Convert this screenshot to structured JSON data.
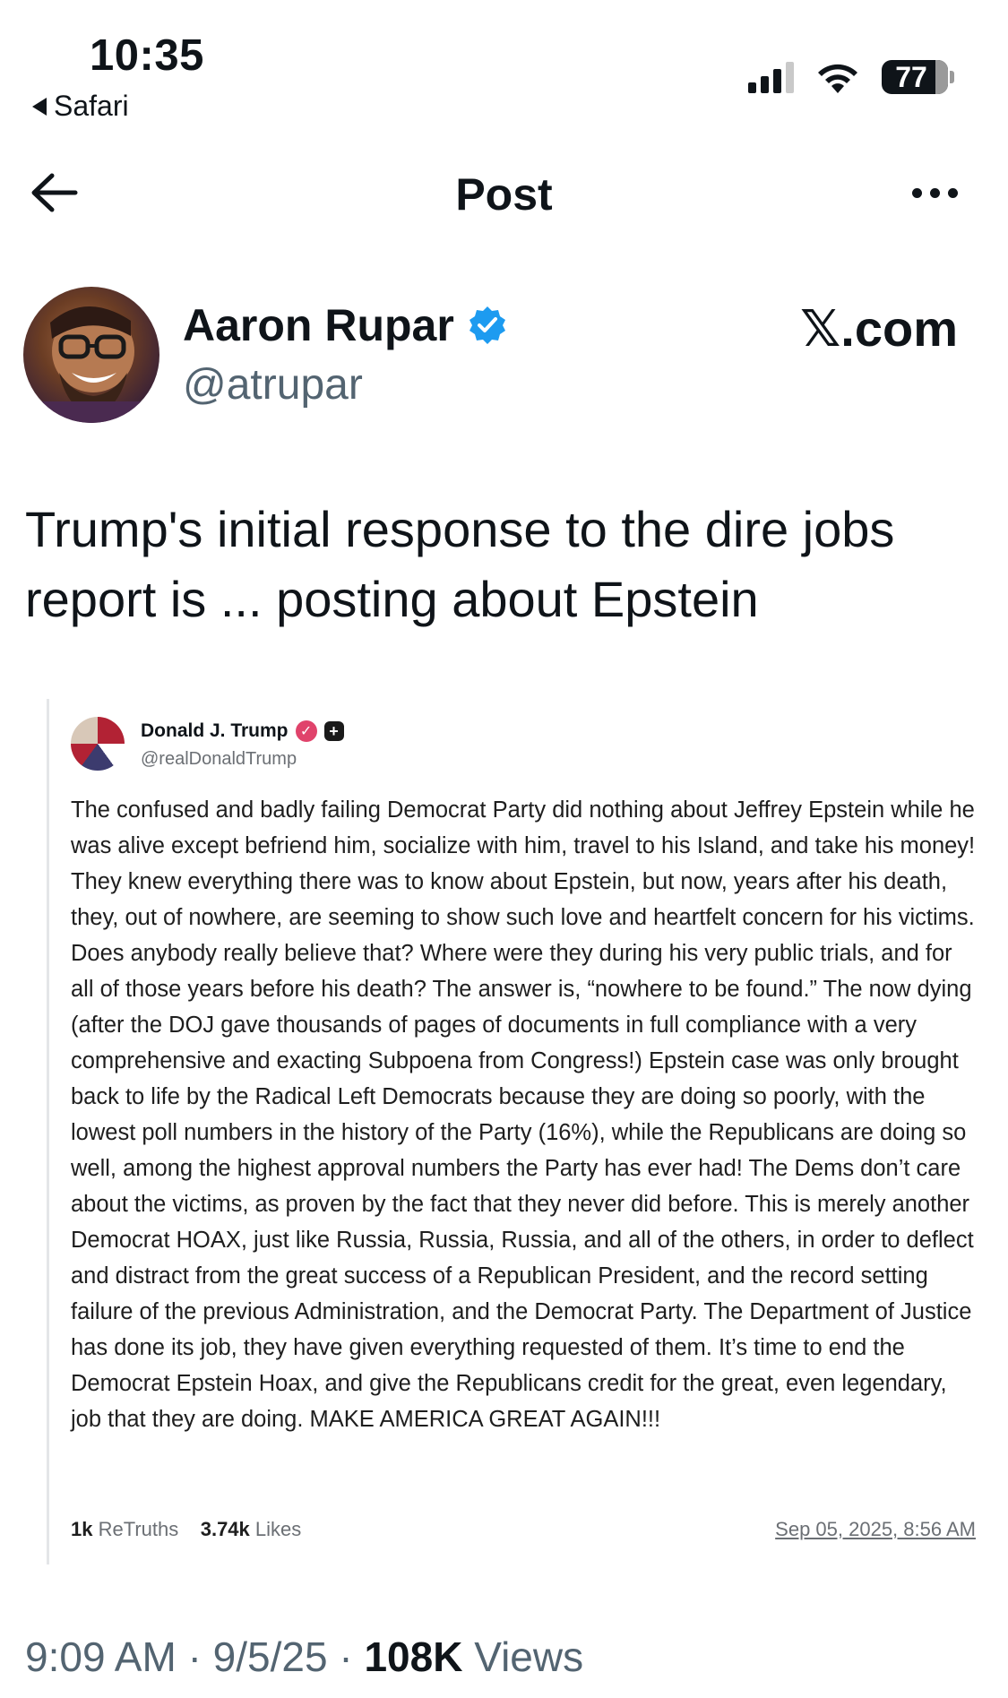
{
  "status_bar": {
    "time": "10:35",
    "back_app": "Safari",
    "battery": "77"
  },
  "header": {
    "title": "Post"
  },
  "author": {
    "name": "Aaron Rupar",
    "handle": "@atrupar",
    "site": "𝕏.com",
    "verified_color": "#1d9bf0"
  },
  "tweet": {
    "text": "Trump's initial response to the dire jobs report is ... posting about Epstein"
  },
  "embedded_post": {
    "name": "Donald J. Trump",
    "handle": "@realDonaldTrump",
    "body": "The confused and badly failing Democrat Party did nothing about Jeffrey Epstein while he was alive except befriend him, socialize with him, travel to his Island, and take his money! They knew everything there was to know about Epstein, but now, years after his death, they, out of nowhere, are seeming to show such love and heartfelt concern for his victims. Does anybody really believe that? Where were they during his very public trials, and for all of those years before his death? The answer is, “nowhere to be found.” The now dying (after the DOJ gave thousands of pages of documents in full compliance with a very comprehensive and exacting Subpoena from Congress!) Epstein case was only brought back to life by the Radical Left Democrats because they are doing so poorly, with the lowest poll numbers in the history of the Party (16%), while the Republicans are doing so well, among the highest approval numbers the Party has ever had! The Dems don’t care about the victims, as proven by the fact that they never did before. This is merely another Democrat HOAX, just like Russia, Russia, Russia, and all of the others, in order to deflect and distract from the great success of a Republican President, and the record setting failure of the previous Administration, and the Democrat Party. The Department of Justice has done its job, they have given everything requested of them. It’s time to end the Democrat Epstein Hoax, and give the Republicans credit for the great, even legendary, job that they are doing. MAKE AMERICA GREAT AGAIN!!!",
    "retruths_count": "1k",
    "retruths_label": "ReTruths",
    "likes_count": "3.74k",
    "likes_label": "Likes",
    "date": "Sep 05, 2025, 8:56 AM"
  },
  "meta": {
    "time": "9:09 AM",
    "date": "9/5/25",
    "views_count": "108K",
    "views_label": "Views"
  }
}
